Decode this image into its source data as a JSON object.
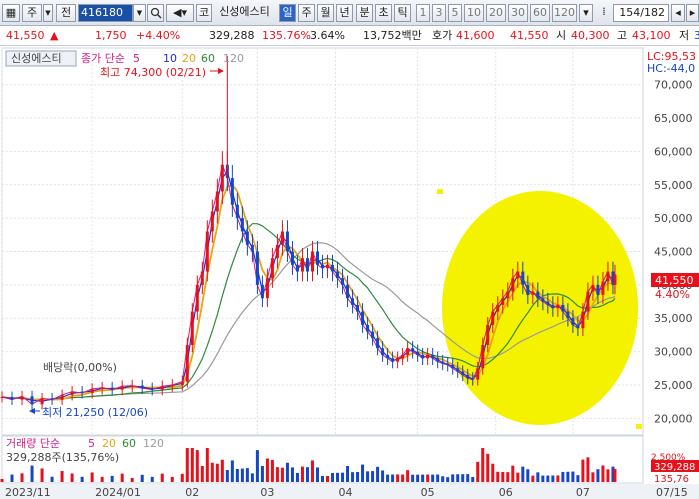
{
  "toolbar": {
    "tab1": "주",
    "tab2": "전",
    "code": "416180",
    "market": "코",
    "name": "신성에스티",
    "periods": [
      "일",
      "주",
      "월",
      "년",
      "분",
      "초",
      "틱"
    ],
    "active_period": "일",
    "intervals": [
      "1",
      "3",
      "5",
      "10",
      "20",
      "30",
      "60",
      "120"
    ],
    "page": "154/182"
  },
  "quote": {
    "price": "41,550",
    "change_arrow": "▲",
    "change": "1,750",
    "change_pct": "+4.40%",
    "volume": "329,288",
    "volume_pct": "135.76%",
    "turnover": "3.64%",
    "amount": "13,752백만",
    "ask_label": "호가",
    "ask1": "41,600",
    "ask2": "41,550",
    "open_label": "시",
    "open": "40,300",
    "high_label": "고",
    "high": "43,100",
    "extra_label": "저",
    "extra": "3"
  },
  "chart_labels": {
    "title_box": "신성에스티",
    "legend_main": "종가 단순",
    "ma_periods": [
      "5",
      "10",
      "20",
      "60",
      "120"
    ],
    "max_label": "최고 74,300 (02/21)",
    "min_label": "최저 21,250 (12/06)",
    "dividend_label": "배당락(0,00%)",
    "lc_label": "LC:95,53",
    "hc_label": "HC:-44,0",
    "price_tag": "41,550",
    "pct_tag": "4.40%",
    "vol_legend": "거래량 단순",
    "vol_periods": [
      "5",
      "20",
      "60",
      "120"
    ],
    "vol_value": "329,288주(135,76%)",
    "vol_tag1": "329,288",
    "vol_tag2": "135,76",
    "vol_axis": "2,500%"
  },
  "colors": {
    "up": "#e8111b",
    "down": "#1446c8",
    "ma5": "#d81b86",
    "ma10": "#2330c8",
    "ma20": "#e8a50f",
    "ma60": "#2e8b3a",
    "ma120": "#9a9a9a",
    "highlight": "#f5f200"
  },
  "chart_data": {
    "type": "candlestick",
    "y_ticks": [
      20000,
      25000,
      30000,
      35000,
      40000,
      45000,
      50000,
      55000,
      60000,
      65000,
      70000
    ],
    "ylim": [
      17500,
      75500
    ],
    "x_ticks": [
      "2023/11",
      "2024/01",
      "02",
      "03",
      "04",
      "05",
      "06",
      "07",
      "07/15"
    ],
    "close_series": [
      {
        "t": 0,
        "v": 23200
      },
      {
        "t": 10,
        "v": 22800
      },
      {
        "t": 20,
        "v": 23300
      },
      {
        "t": 30,
        "v": 22100
      },
      {
        "t": 40,
        "v": 23000
      },
      {
        "t": 50,
        "v": 22800
      },
      {
        "t": 60,
        "v": 23500
      },
      {
        "t": 70,
        "v": 24000
      },
      {
        "t": 80,
        "v": 23800
      },
      {
        "t": 90,
        "v": 24400
      },
      {
        "t": 100,
        "v": 24600
      },
      {
        "t": 110,
        "v": 24300
      },
      {
        "t": 120,
        "v": 24800
      },
      {
        "t": 130,
        "v": 24900
      },
      {
        "t": 140,
        "v": 24500
      },
      {
        "t": 150,
        "v": 24300
      },
      {
        "t": 160,
        "v": 24800
      },
      {
        "t": 170,
        "v": 25000
      },
      {
        "t": 180,
        "v": 25500
      },
      {
        "t": 185,
        "v": 31000
      },
      {
        "t": 190,
        "v": 36000
      },
      {
        "t": 195,
        "v": 40000
      },
      {
        "t": 200,
        "v": 42000
      },
      {
        "t": 205,
        "v": 48000
      },
      {
        "t": 210,
        "v": 51000
      },
      {
        "t": 215,
        "v": 54000
      },
      {
        "t": 220,
        "v": 58000
      },
      {
        "t": 225,
        "v": 56000
      },
      {
        "t": 230,
        "v": 52000
      },
      {
        "t": 235,
        "v": 50000
      },
      {
        "t": 240,
        "v": 48000
      },
      {
        "t": 245,
        "v": 46000
      },
      {
        "t": 250,
        "v": 45000
      },
      {
        "t": 255,
        "v": 40000
      },
      {
        "t": 260,
        "v": 38000
      },
      {
        "t": 265,
        "v": 41000
      },
      {
        "t": 270,
        "v": 44000
      },
      {
        "t": 275,
        "v": 46000
      },
      {
        "t": 280,
        "v": 48000
      },
      {
        "t": 285,
        "v": 45000
      },
      {
        "t": 290,
        "v": 43000
      },
      {
        "t": 295,
        "v": 42000
      },
      {
        "t": 300,
        "v": 44000
      },
      {
        "t": 305,
        "v": 42000
      },
      {
        "t": 310,
        "v": 45000
      },
      {
        "t": 315,
        "v": 43000
      },
      {
        "t": 320,
        "v": 42500
      },
      {
        "t": 325,
        "v": 43000
      },
      {
        "t": 330,
        "v": 42000
      },
      {
        "t": 335,
        "v": 41000
      },
      {
        "t": 340,
        "v": 40000
      },
      {
        "t": 345,
        "v": 38000
      },
      {
        "t": 350,
        "v": 37000
      },
      {
        "t": 355,
        "v": 36000
      },
      {
        "t": 360,
        "v": 34000
      },
      {
        "t": 365,
        "v": 33000
      },
      {
        "t": 370,
        "v": 32000
      },
      {
        "t": 375,
        "v": 30500
      },
      {
        "t": 380,
        "v": 29500
      },
      {
        "t": 385,
        "v": 29000
      },
      {
        "t": 390,
        "v": 28500
      },
      {
        "t": 395,
        "v": 29000
      },
      {
        "t": 400,
        "v": 29500
      },
      {
        "t": 405,
        "v": 30500
      },
      {
        "t": 410,
        "v": 30000
      },
      {
        "t": 415,
        "v": 29500
      },
      {
        "t": 420,
        "v": 29000
      },
      {
        "t": 425,
        "v": 29500
      },
      {
        "t": 430,
        "v": 29000
      },
      {
        "t": 435,
        "v": 28500
      },
      {
        "t": 440,
        "v": 28200
      },
      {
        "t": 445,
        "v": 28000
      },
      {
        "t": 450,
        "v": 27500
      },
      {
        "t": 455,
        "v": 27000
      },
      {
        "t": 460,
        "v": 26500
      },
      {
        "t": 465,
        "v": 26000
      },
      {
        "t": 470,
        "v": 25800
      },
      {
        "t": 475,
        "v": 27500
      },
      {
        "t": 480,
        "v": 31000
      },
      {
        "t": 485,
        "v": 34000
      },
      {
        "t": 490,
        "v": 36000
      },
      {
        "t": 495,
        "v": 37000
      },
      {
        "t": 500,
        "v": 38000
      },
      {
        "t": 505,
        "v": 39000
      },
      {
        "t": 510,
        "v": 41000
      },
      {
        "t": 515,
        "v": 42000
      },
      {
        "t": 520,
        "v": 40000
      },
      {
        "t": 525,
        "v": 38500
      },
      {
        "t": 530,
        "v": 39000
      },
      {
        "t": 535,
        "v": 38000
      },
      {
        "t": 540,
        "v": 37500
      },
      {
        "t": 545,
        "v": 37000
      },
      {
        "t": 550,
        "v": 36500
      },
      {
        "t": 555,
        "v": 37000
      },
      {
        "t": 560,
        "v": 36000
      },
      {
        "t": 565,
        "v": 35000
      },
      {
        "t": 570,
        "v": 34000
      },
      {
        "t": 575,
        "v": 33500
      },
      {
        "t": 580,
        "v": 36000
      },
      {
        "t": 585,
        "v": 39000
      },
      {
        "t": 590,
        "v": 40000
      },
      {
        "t": 595,
        "v": 38500
      },
      {
        "t": 600,
        "v": 40500
      },
      {
        "t": 605,
        "v": 42000
      },
      {
        "t": 610,
        "v": 40000
      },
      {
        "t": 612,
        "v": 41550
      }
    ]
  }
}
